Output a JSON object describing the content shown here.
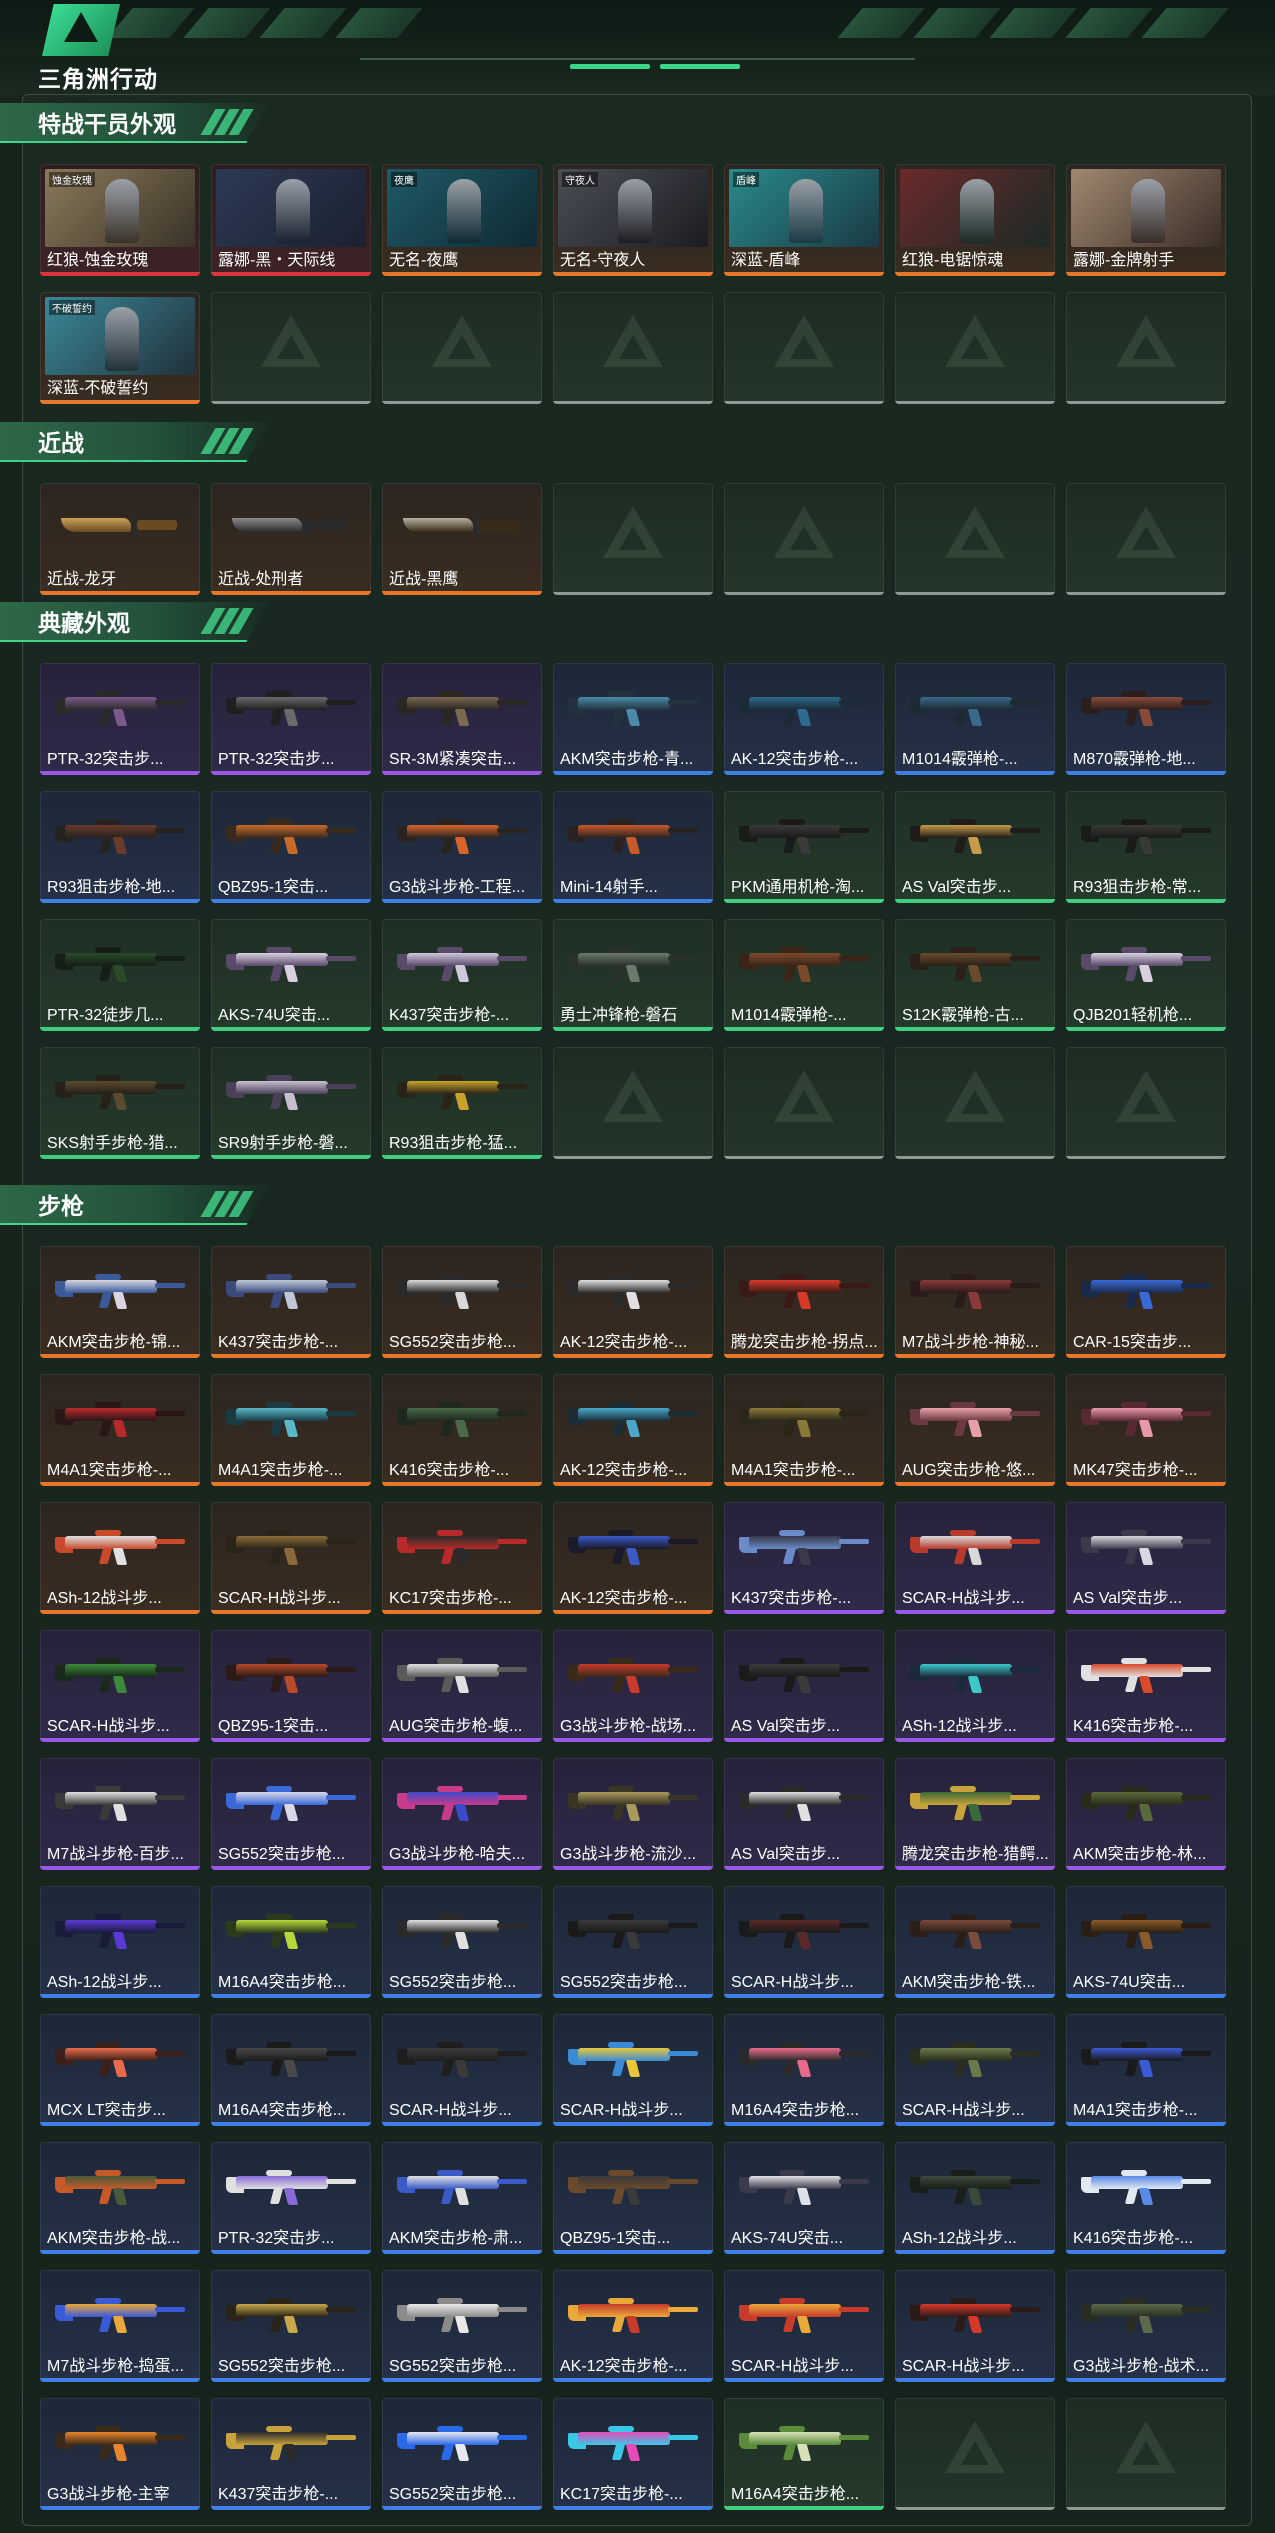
{
  "header": {
    "app_title": "三角洲行动"
  },
  "sections": [
    {
      "title": "特战干员外观",
      "kind": "operator",
      "items": [
        {
          "label": "红狼-蚀金玫瑰",
          "rarity": "red",
          "tag": "蚀金玫瑰",
          "colors": [
            "#8a7a5a",
            "#3a3328"
          ]
        },
        {
          "label": "露娜-黑・天际线",
          "rarity": "red",
          "tag": "",
          "colors": [
            "#2d3a55",
            "#1a2130"
          ]
        },
        {
          "label": "无名-夜鹰",
          "rarity": "orange",
          "tag": "夜鹰",
          "colors": [
            "#1f5a66",
            "#0f2a33"
          ]
        },
        {
          "label": "无名-守夜人",
          "rarity": "orange",
          "tag": "守夜人",
          "colors": [
            "#4a4e55",
            "#1b1d22"
          ]
        },
        {
          "label": "深蓝-盾峰",
          "rarity": "orange",
          "tag": "盾峰",
          "colors": [
            "#2a8a8a",
            "#1a3a44"
          ]
        },
        {
          "label": "红狼-电锯惊魂",
          "rarity": "orange",
          "tag": "",
          "colors": [
            "#6a2a2a",
            "#1c2a26"
          ]
        },
        {
          "label": "露娜-金牌射手",
          "rarity": "orange",
          "tag": "",
          "colors": [
            "#a08870",
            "#3a2e28"
          ]
        },
        {
          "label": "深蓝-不破誓约",
          "rarity": "orange",
          "tag": "不破誓约",
          "colors": [
            "#3a8898",
            "#22313a"
          ]
        },
        {
          "label": "",
          "rarity": "empty"
        },
        {
          "label": "",
          "rarity": "empty"
        },
        {
          "label": "",
          "rarity": "empty"
        },
        {
          "label": "",
          "rarity": "empty"
        },
        {
          "label": "",
          "rarity": "empty"
        },
        {
          "label": "",
          "rarity": "empty"
        }
      ]
    },
    {
      "title": "近战",
      "kind": "knife",
      "items": [
        {
          "label": "近战-龙牙",
          "rarity": "orange",
          "colors": [
            "#c9a25a",
            "#6a4a22"
          ]
        },
        {
          "label": "近战-处刑者",
          "rarity": "orange",
          "colors": [
            "#8a8a8a",
            "#2a2a2a"
          ]
        },
        {
          "label": "近战-黑鹰",
          "rarity": "orange",
          "colors": [
            "#b8b0a0",
            "#3a2a1a"
          ]
        },
        {
          "label": "",
          "rarity": "empty"
        },
        {
          "label": "",
          "rarity": "empty"
        },
        {
          "label": "",
          "rarity": "empty"
        },
        {
          "label": "",
          "rarity": "empty"
        }
      ]
    },
    {
      "title": "典藏外观",
      "kind": "gun",
      "items": [
        {
          "label": "PTR-32突击步...",
          "rarity": "purple",
          "colors": [
            "#7a5a8a",
            "#2a2a2a"
          ]
        },
        {
          "label": "PTR-32突击步...",
          "rarity": "purple",
          "colors": [
            "#6a6a6a",
            "#1f1f1f"
          ]
        },
        {
          "label": "SR-3M紧凑突击...",
          "rarity": "purple",
          "colors": [
            "#7a6a50",
            "#2a2622"
          ]
        },
        {
          "label": "AKM突击步枪-青...",
          "rarity": "blue",
          "colors": [
            "#4a8aa8",
            "#22333d"
          ]
        },
        {
          "label": "AK-12突击步枪-...",
          "rarity": "blue",
          "colors": [
            "#2d6a8e",
            "#1a2a36"
          ]
        },
        {
          "label": "M1014霰弹枪-...",
          "rarity": "blue",
          "colors": [
            "#3a6a8a",
            "#1b2a33"
          ]
        },
        {
          "label": "M870霰弹枪-地...",
          "rarity": "blue",
          "colors": [
            "#8a4a3a",
            "#2a1f1c"
          ]
        },
        {
          "label": "R93狙击步枪-地...",
          "rarity": "blue",
          "colors": [
            "#6a3a2a",
            "#262220"
          ]
        },
        {
          "label": "QBZ95-1突击...",
          "rarity": "blue",
          "colors": [
            "#c86a2a",
            "#3a2a1e"
          ]
        },
        {
          "label": "G3战斗步枪-工程...",
          "rarity": "blue",
          "colors": [
            "#d8642a",
            "#2a2420"
          ]
        },
        {
          "label": "Mini-14射手...",
          "rarity": "blue",
          "colors": [
            "#c85a2a",
            "#2a2220"
          ]
        },
        {
          "label": "PKM通用机枪-淘...",
          "rarity": "green",
          "colors": [
            "#3a3a3a",
            "#1a1a1a"
          ]
        },
        {
          "label": "AS Val突击步...",
          "rarity": "green",
          "colors": [
            "#c89a4a",
            "#1e1c18"
          ]
        },
        {
          "label": "R93狙击步枪-常...",
          "rarity": "green",
          "colors": [
            "#3a3a34",
            "#1a1a18"
          ]
        },
        {
          "label": "PTR-32徒步几...",
          "rarity": "green",
          "colors": [
            "#2a4a2a",
            "#151f15"
          ]
        },
        {
          "label": "AKS-74U突击...",
          "rarity": "green",
          "colors": [
            "#d8d0e0",
            "#5a4a6a"
          ]
        },
        {
          "label": "K437突击步枪-...",
          "rarity": "green",
          "colors": [
            "#d0c8dc",
            "#5a4a6a"
          ]
        },
        {
          "label": "勇士冲锋枪-磐石",
          "rarity": "green",
          "colors": [
            "#6a7a6a",
            "#2a302a"
          ]
        },
        {
          "label": "M1014霰弹枪-...",
          "rarity": "green",
          "colors": [
            "#7a4a2a",
            "#3a2418"
          ]
        },
        {
          "label": "S12K霰弹枪-古...",
          "rarity": "green",
          "colors": [
            "#6a4a2a",
            "#2a2018"
          ]
        },
        {
          "label": "QJB201轻机枪...",
          "rarity": "green",
          "colors": [
            "#d8d0e0",
            "#5a4a6a"
          ]
        },
        {
          "label": "SKS射手步枪-猎...",
          "rarity": "green",
          "colors": [
            "#5a4a30",
            "#252018"
          ]
        },
        {
          "label": "SR9射手步枪-磐...",
          "rarity": "green",
          "colors": [
            "#c8c0d0",
            "#4a4058"
          ]
        },
        {
          "label": "R93狙击步枪-猛...",
          "rarity": "green",
          "colors": [
            "#c8a22a",
            "#2a2418"
          ]
        },
        {
          "label": "",
          "rarity": "empty"
        },
        {
          "label": "",
          "rarity": "empty"
        },
        {
          "label": "",
          "rarity": "empty"
        },
        {
          "label": "",
          "rarity": "empty"
        }
      ]
    },
    {
      "title": "步枪",
      "kind": "gun",
      "items": [
        {
          "label": "AKM突击步枪-锦...",
          "rarity": "orange",
          "colors": [
            "#d8d4e0",
            "#3a5a9a"
          ]
        },
        {
          "label": "K437突击步枪-...",
          "rarity": "orange",
          "colors": [
            "#c0c8d8",
            "#3a4a7a"
          ]
        },
        {
          "label": "SG552突击步枪...",
          "rarity": "orange",
          "colors": [
            "#d8d8d8",
            "#2a2a2a"
          ]
        },
        {
          "label": "AK-12突击步枪-...",
          "rarity": "orange",
          "colors": [
            "#e0e0e0",
            "#2a2a2a"
          ]
        },
        {
          "label": "腾龙突击步枪-拐点...",
          "rarity": "orange",
          "colors": [
            "#d83a2a",
            "#3a1a16"
          ]
        },
        {
          "label": "M7战斗步枪-神秘...",
          "rarity": "orange",
          "colors": [
            "#8a3a3a",
            "#2a1a1a"
          ]
        },
        {
          "label": "CAR-15突击步...",
          "rarity": "orange",
          "colors": [
            "#3a6ad8",
            "#1a2a4a"
          ]
        },
        {
          "label": "M4A1突击步枪-...",
          "rarity": "orange",
          "colors": [
            "#b82a2a",
            "#2a1616"
          ]
        },
        {
          "label": "M4A1突击步枪-...",
          "rarity": "orange",
          "colors": [
            "#5ab8c8",
            "#1a3a44"
          ]
        },
        {
          "label": "K416突击步枪-...",
          "rarity": "orange",
          "colors": [
            "#4a6a4a",
            "#1e281e"
          ]
        },
        {
          "label": "AK-12突击步枪-...",
          "rarity": "orange",
          "colors": [
            "#4aa8c8",
            "#1a2e38"
          ]
        },
        {
          "label": "M4A1突击步枪-...",
          "rarity": "orange",
          "colors": [
            "#8a7a3a",
            "#2a2618"
          ]
        },
        {
          "label": "AUG突击步枪-悠...",
          "rarity": "orange",
          "colors": [
            "#e8a0a8",
            "#6a3a40"
          ]
        },
        {
          "label": "MK47突击步枪-...",
          "rarity": "orange",
          "colors": [
            "#e898a8",
            "#5a2a34"
          ]
        },
        {
          "label": "ASh-12战斗步...",
          "rarity": "orange",
          "colors": [
            "#e0e0e0",
            "#c84a2a"
          ]
        },
        {
          "label": "SCAR-H战斗步...",
          "rarity": "orange",
          "colors": [
            "#8a6a3a",
            "#2a2418"
          ]
        },
        {
          "label": "KC17突击步枪-...",
          "rarity": "orange",
          "colors": [
            "#2a2a2a",
            "#b82a2a"
          ]
        },
        {
          "label": "AK-12突击步枪-...",
          "rarity": "orange",
          "colors": [
            "#3a5ac8",
            "#1a1a2a"
          ]
        },
        {
          "label": "K437突击步枪-...",
          "rarity": "purple",
          "colors": [
            "#3a3a4a",
            "#6a8ac8"
          ]
        },
        {
          "label": "SCAR-H战斗步...",
          "rarity": "purple",
          "colors": [
            "#d8d8d8",
            "#b83a2a"
          ]
        },
        {
          "label": "AS Val突击步...",
          "rarity": "purple",
          "colors": [
            "#d8d8e0",
            "#3a3a4a"
          ]
        },
        {
          "label": "SCAR-H战斗步...",
          "rarity": "purple",
          "colors": [
            "#3a8a3a",
            "#1a2a1a"
          ]
        },
        {
          "label": "QBZ95-1突击...",
          "rarity": "purple",
          "colors": [
            "#b84a2a",
            "#2a1a18"
          ]
        },
        {
          "label": "AUG突击步枪-蝮...",
          "rarity": "purple",
          "colors": [
            "#e0e0e0",
            "#5a5a5a"
          ]
        },
        {
          "label": "G3战斗步枪-战场...",
          "rarity": "purple",
          "colors": [
            "#c83a2a",
            "#3a2a1a"
          ]
        },
        {
          "label": "AS Val突击步...",
          "rarity": "purple",
          "colors": [
            "#3a3a3a",
            "#1a1a1a"
          ]
        },
        {
          "label": "ASh-12战斗步...",
          "rarity": "purple",
          "colors": [
            "#3ac8c8",
            "#1a2a3a"
          ]
        },
        {
          "label": "K416突击步枪-...",
          "rarity": "purple",
          "colors": [
            "#d84a2a",
            "#e0e0e0"
          ]
        },
        {
          "label": "M7战斗步枪-百步...",
          "rarity": "purple",
          "colors": [
            "#e0e0e0",
            "#3a3a3a"
          ]
        },
        {
          "label": "SG552突击步枪...",
          "rarity": "purple",
          "colors": [
            "#d8d8e8",
            "#3a6ad8"
          ]
        },
        {
          "label": "G3战斗步枪-哈夫...",
          "rarity": "purple",
          "colors": [
            "#3a4ac8",
            "#c83a8a"
          ]
        },
        {
          "label": "G3战斗步枪-流沙...",
          "rarity": "purple",
          "colors": [
            "#a89a5a",
            "#3a3424"
          ]
        },
        {
          "label": "AS Val突击步...",
          "rarity": "purple",
          "colors": [
            "#e0e0e0",
            "#2a2a2a"
          ]
        },
        {
          "label": "腾龙突击步枪-猎鳄...",
          "rarity": "purple",
          "colors": [
            "#3a6a3a",
            "#c8a23a"
          ]
        },
        {
          "label": "AKM突击步枪-林...",
          "rarity": "purple",
          "colors": [
            "#5a6a3a",
            "#2a2a1a"
          ]
        },
        {
          "label": "ASh-12战斗步...",
          "rarity": "blue",
          "colors": [
            "#5a3ad8",
            "#1a1a3a"
          ]
        },
        {
          "label": "M16A4突击步枪...",
          "rarity": "blue",
          "colors": [
            "#b8d83a",
            "#2a3a1a"
          ]
        },
        {
          "label": "SG552突击步枪...",
          "rarity": "blue",
          "colors": [
            "#e0e0e0",
            "#2a2a2a"
          ]
        },
        {
          "label": "SG552突击步枪...",
          "rarity": "blue",
          "colors": [
            "#3a3a3a",
            "#1a1a1a"
          ]
        },
        {
          "label": "SCAR-H战斗步...",
          "rarity": "blue",
          "colors": [
            "#5a2a2a",
            "#1a1a1a"
          ]
        },
        {
          "label": "AKM突击步枪-铁...",
          "rarity": "blue",
          "colors": [
            "#7a4a3a",
            "#2a1e18"
          ]
        },
        {
          "label": "AKS-74U突击...",
          "rarity": "blue",
          "colors": [
            "#8a5a2a",
            "#2a1e14"
          ]
        },
        {
          "label": "MCX LT突击步...",
          "rarity": "blue",
          "colors": [
            "#e86a4a",
            "#3a2018"
          ]
        },
        {
          "label": "M16A4突击步枪...",
          "rarity": "blue",
          "colors": [
            "#4a4a4a",
            "#1a1a1a"
          ]
        },
        {
          "label": "SCAR-H战斗步...",
          "rarity": "blue",
          "colors": [
            "#3a3a3a",
            "#1e1e1e"
          ]
        },
        {
          "label": "SCAR-H战斗步...",
          "rarity": "blue",
          "colors": [
            "#e8c83a",
            "#3a8ad8"
          ]
        },
        {
          "label": "M16A4突击步枪...",
          "rarity": "blue",
          "colors": [
            "#e86a8a",
            "#2a2a2a"
          ]
        },
        {
          "label": "SCAR-H战斗步...",
          "rarity": "blue",
          "colors": [
            "#6a7a4a",
            "#2a2e1e"
          ]
        },
        {
          "label": "M4A1突击步枪-...",
          "rarity": "blue",
          "colors": [
            "#3a5ad8",
            "#1a1a1a"
          ]
        },
        {
          "label": "AKM突击步枪-战...",
          "rarity": "blue",
          "colors": [
            "#4a5a3a",
            "#c85a2a"
          ]
        },
        {
          "label": "PTR-32突击步...",
          "rarity": "blue",
          "colors": [
            "#8a6ad8",
            "#e0e0e0"
          ]
        },
        {
          "label": "AKM突击步枪-肃...",
          "rarity": "blue",
          "colors": [
            "#e0e0e0",
            "#3a5ac8"
          ]
        },
        {
          "label": "QBZ95-1突击...",
          "rarity": "blue",
          "colors": [
            "#3a3a3a",
            "#6a4a2a"
          ]
        },
        {
          "label": "AKS-74U突击...",
          "rarity": "blue",
          "colors": [
            "#e0e0e8",
            "#3a3a4a"
          ]
        },
        {
          "label": "ASh-12战斗步...",
          "rarity": "blue",
          "colors": [
            "#3a4a3a",
            "#1a1e1a"
          ]
        },
        {
          "label": "K416突击步枪-...",
          "rarity": "blue",
          "colors": [
            "#5a8ae8",
            "#e0e8f0"
          ]
        },
        {
          "label": "M7战斗步枪-捣蛋...",
          "rarity": "blue",
          "colors": [
            "#e8a83a",
            "#3a5ad8"
          ]
        },
        {
          "label": "SG552突击步枪...",
          "rarity": "blue",
          "colors": [
            "#c8a84a",
            "#2a2418"
          ]
        },
        {
          "label": "SG552突击步枪...",
          "rarity": "blue",
          "colors": [
            "#e8e8e8",
            "#8a8a8a"
          ]
        },
        {
          "label": "AK-12突击步枪-...",
          "rarity": "blue",
          "colors": [
            "#c83a2a",
            "#e8a83a"
          ]
        },
        {
          "label": "SCAR-H战斗步...",
          "rarity": "blue",
          "colors": [
            "#e8a83a",
            "#c83a2a"
          ]
        },
        {
          "label": "SCAR-H战斗步...",
          "rarity": "blue",
          "colors": [
            "#d8382a",
            "#2a1a18"
          ]
        },
        {
          "label": "G3战斗步枪-战术...",
          "rarity": "blue",
          "colors": [
            "#5a6a4a",
            "#2a2e22"
          ]
        },
        {
          "label": "G3战斗步枪-主宰",
          "rarity": "blue",
          "colors": [
            "#e8842a",
            "#3a2a1a"
          ]
        },
        {
          "label": "K437突击步枪-...",
          "rarity": "blue",
          "colors": [
            "#2a2a2a",
            "#c8a23a"
          ]
        },
        {
          "label": "SG552突击步枪...",
          "rarity": "blue",
          "colors": [
            "#e8e8f0",
            "#2a6ae8"
          ]
        },
        {
          "label": "KC17突击步枪-...",
          "rarity": "blue",
          "colors": [
            "#e84ab8",
            "#3ac8e8"
          ]
        },
        {
          "label": "M16A4突击步枪...",
          "rarity": "green",
          "colors": [
            "#d8e0b8",
            "#5a8a3a"
          ]
        },
        {
          "label": "",
          "rarity": "empty"
        },
        {
          "label": "",
          "rarity": "empty"
        }
      ]
    }
  ]
}
